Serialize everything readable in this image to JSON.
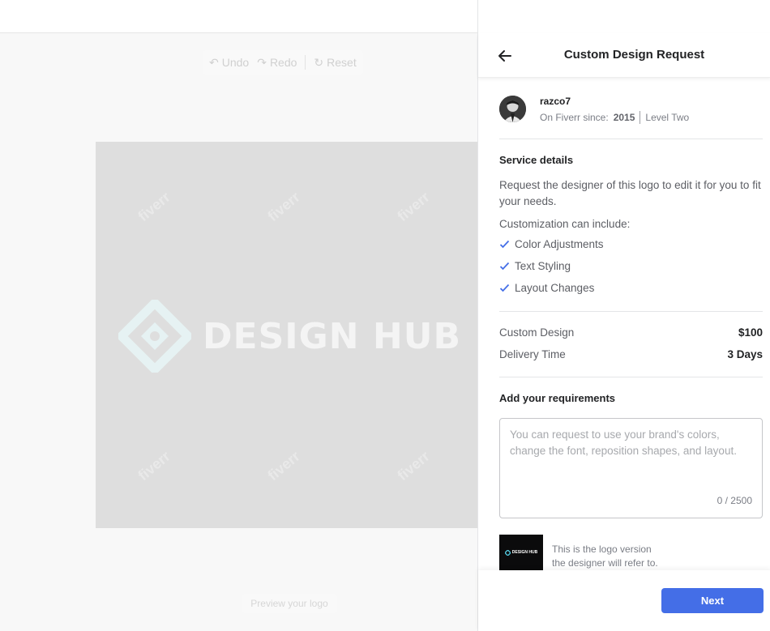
{
  "toolbar": {
    "undo_label": "Undo",
    "redo_label": "Redo",
    "reset_label": "Reset"
  },
  "canvas": {
    "logo_text": "DESIGN HUB",
    "watermark": "fiverr"
  },
  "preview_button": {
    "label": "Preview your logo"
  },
  "panel": {
    "title": "Custom Design Request",
    "seller": {
      "name": "razco7",
      "since_label": "On Fiverr since:",
      "since_year": "2015",
      "level": "Level Two"
    },
    "service": {
      "heading": "Service details",
      "description": "Request the designer of this logo to edit it for you to fit your needs.",
      "custom_label": "Customization can include:",
      "items": [
        "Color Adjustments",
        "Text Styling",
        "Layout Changes"
      ]
    },
    "pricing": {
      "design_label": "Custom Design",
      "design_value": "$100",
      "delivery_label": "Delivery Time",
      "delivery_value": "3 Days"
    },
    "requirements": {
      "heading": "Add your requirements",
      "placeholder": "You can request to use your brand's colors, change the font, reposition shapes, and layout.",
      "counter": "0 / 2500"
    },
    "reference": {
      "thumb_text": "DESIGN HUB",
      "line1": "This is the logo version",
      "line2": "the designer will refer to."
    },
    "next_label": "Next"
  },
  "colors": {
    "accent": "#446ee7",
    "check": "#446ee7",
    "canvas": "#dedede"
  }
}
